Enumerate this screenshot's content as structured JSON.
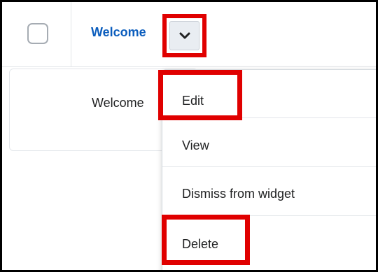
{
  "header": {
    "title": "Welcome"
  },
  "card": {
    "text": "Welcome"
  },
  "menu": {
    "items": [
      {
        "label": "Edit"
      },
      {
        "label": "View"
      },
      {
        "label": "Dismiss from widget"
      },
      {
        "label": "Delete"
      }
    ]
  },
  "icons": {
    "dropdown": "chevron-down-icon",
    "checkbox": "checkbox-icon"
  },
  "colors": {
    "link": "#0b5dbd",
    "highlight": "#e00000",
    "button_bg": "#e9edf2"
  }
}
